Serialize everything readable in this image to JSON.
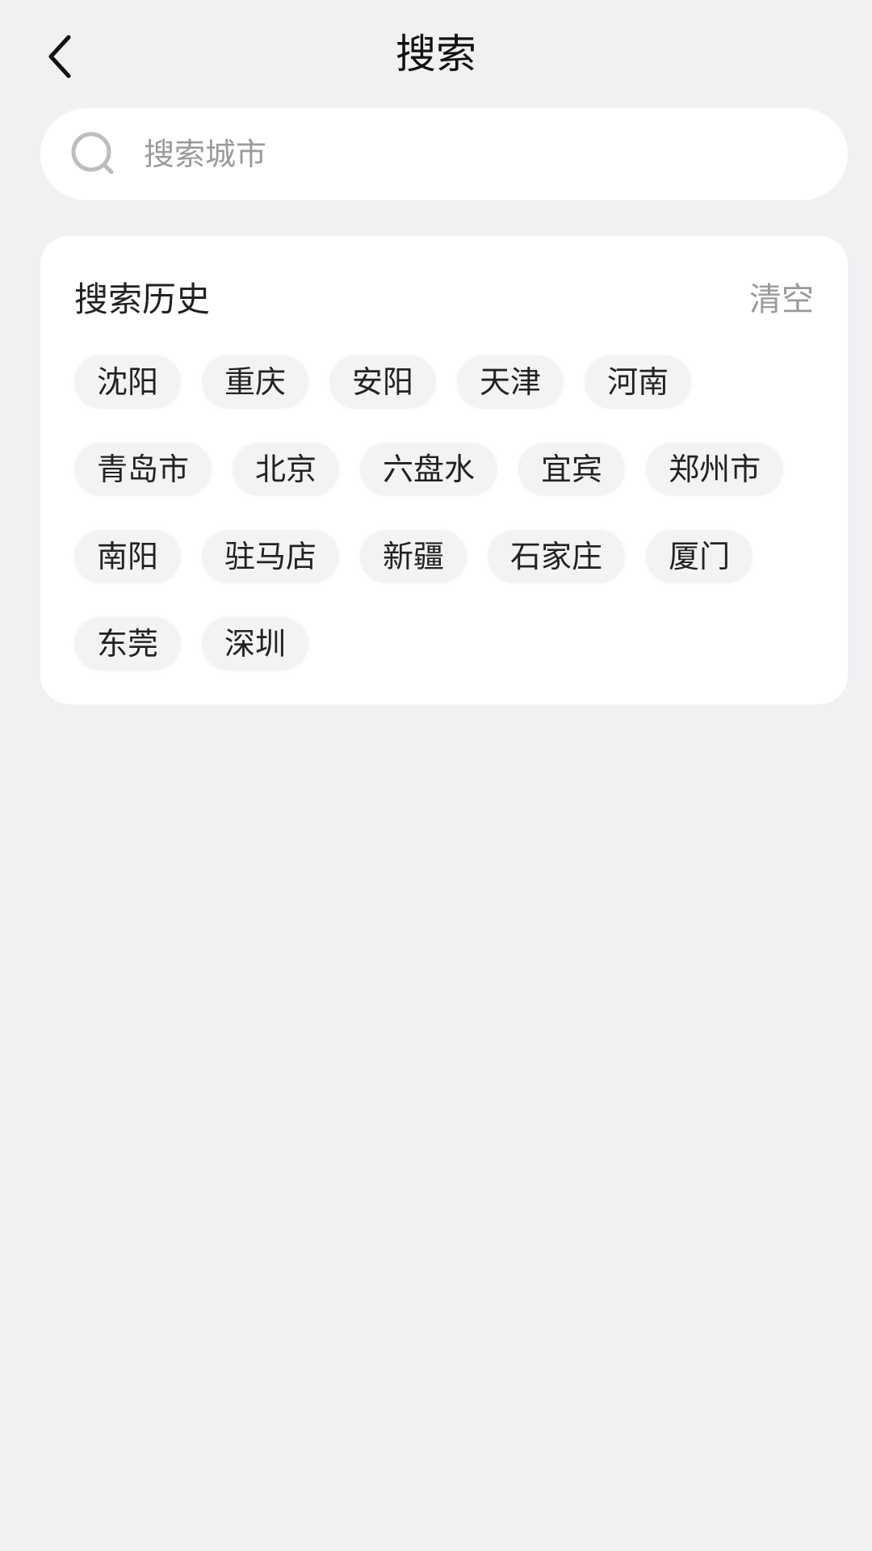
{
  "header": {
    "title": "搜索"
  },
  "search": {
    "placeholder": "搜索城市",
    "value": ""
  },
  "history": {
    "title": "搜索历史",
    "clear_label": "清空",
    "tags": [
      "沈阳",
      "重庆",
      "安阳",
      "天津",
      "河南",
      "青岛市",
      "北京",
      "六盘水",
      "宜宾",
      "郑州市",
      "南阳",
      "驻马店",
      "新疆",
      "石家庄",
      "厦门",
      "东莞",
      "深圳"
    ]
  },
  "icons": {
    "back": "chevron-left-icon",
    "search": "search-icon"
  },
  "colors": {
    "background": "#f0f1f3",
    "card": "#ffffff",
    "tag_bg": "#f3f3f4",
    "muted_text": "#9a9a9a"
  }
}
